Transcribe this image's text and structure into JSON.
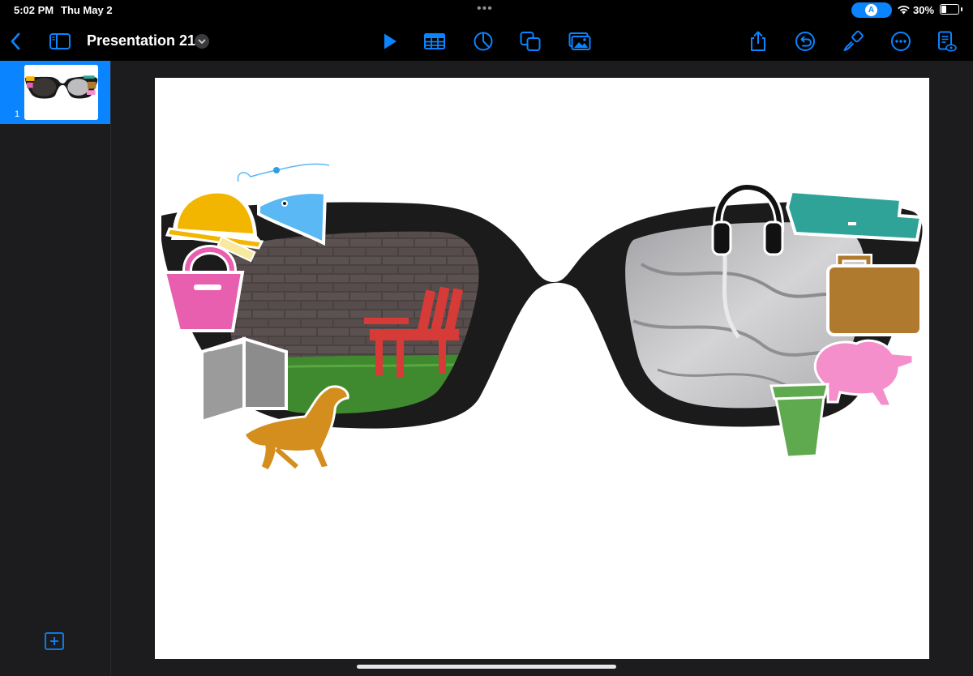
{
  "status_bar": {
    "time": "5:02 PM",
    "date": "Thu May 2",
    "multitask_dots": "•••",
    "location_badge": "A",
    "battery_percent": "30%",
    "battery_level": 0.3,
    "wifi_icon": "wifi-icon"
  },
  "toolbar": {
    "back_icon": "chevron-left-icon",
    "sidebar_icon": "sidebar-icon",
    "document_title": "Presentation 21",
    "title_menu_icon": "chevron-down-icon",
    "center_tools": [
      "play-icon",
      "table-icon",
      "chart-icon",
      "shapes-icon",
      "media-icon"
    ],
    "right_tools": [
      "share-icon",
      "undo-icon",
      "format-brush-icon",
      "more-icon",
      "presenter-notes-icon"
    ],
    "accent_color": "#0a84ff"
  },
  "navigator": {
    "slides": [
      {
        "number": "1",
        "selected": true
      }
    ],
    "add_slide_icon": "plus-icon"
  },
  "slide": {
    "background": "#ffffff",
    "artwork": "sunglasses-collage",
    "left_lens_scene": "red-chair-on-grass",
    "right_lens_scene": "unmade-bed",
    "stickers": [
      "hard-hat",
      "fish",
      "ruler",
      "handbag",
      "book",
      "dog",
      "headphones",
      "sofa",
      "briefcase",
      "piggy-bank",
      "coffee-cup"
    ]
  }
}
